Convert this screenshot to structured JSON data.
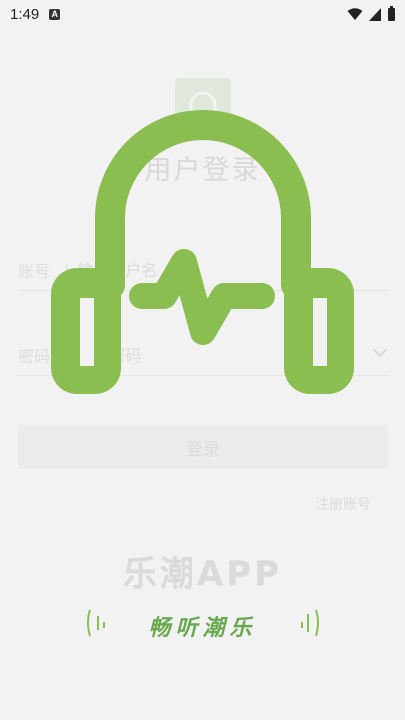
{
  "status_bar": {
    "time": "1:49",
    "notification_badge": "A",
    "icons": [
      "wifi-icon",
      "signal-icon",
      "battery-icon"
    ]
  },
  "login": {
    "title": "用户登录",
    "account_label": "账号",
    "account_placeholder": "输入用户名",
    "password_label": "密码",
    "password_placeholder": "输入密码",
    "divider": "|",
    "dropdown_icon": "chevron-down-icon",
    "login_button": "登录",
    "register_link": "注册账号"
  },
  "splash": {
    "logo_icon": "headphone-pulse-icon",
    "brand": "乐潮APP",
    "slogan": "畅听潮乐",
    "decor_icons": [
      "sound-wave-left-icon",
      "sound-wave-right-icon"
    ],
    "colors": {
      "accent": "#8bbe50",
      "slogan": "#6aa84f",
      "background": "#f2f2f2"
    }
  }
}
